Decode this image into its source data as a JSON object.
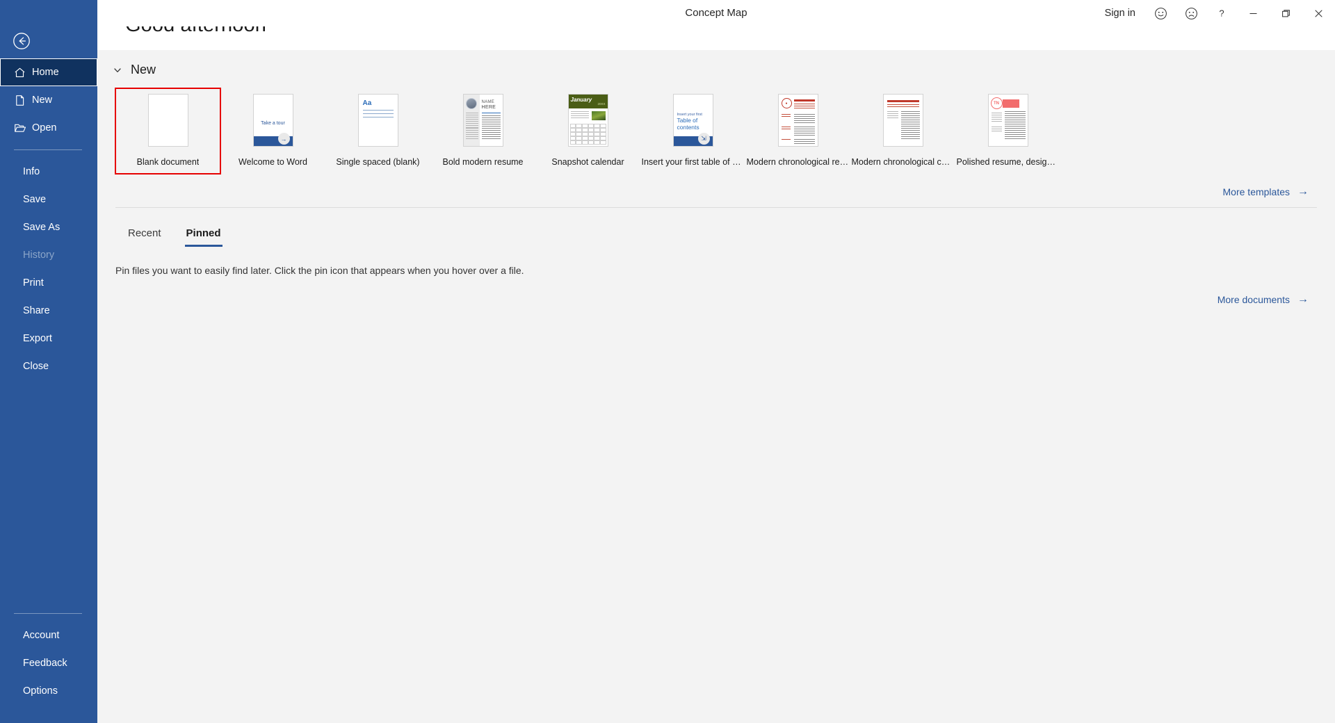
{
  "window": {
    "title": "Concept Map",
    "sign_in": "Sign in",
    "smiley_icon": "smiley-face-icon",
    "frown_icon": "frown-face-icon",
    "help_icon": "help-question-icon",
    "minimize_icon": "minimize-icon",
    "restore_icon": "restore-window-icon",
    "close_icon": "close-window-icon"
  },
  "sidebar": {
    "back_icon": "back-arrow-circle-icon",
    "accent_color": "#2b579a",
    "selected_color": "#10325f",
    "top_items": [
      {
        "label": "Home",
        "icon": "home-icon",
        "selected": true,
        "disabled": false
      },
      {
        "label": "New",
        "icon": "new-document-icon",
        "selected": false,
        "disabled": false
      },
      {
        "label": "Open",
        "icon": "open-folder-icon",
        "selected": false,
        "disabled": false
      }
    ],
    "mid_items": [
      {
        "label": "Info",
        "disabled": false
      },
      {
        "label": "Save",
        "disabled": false
      },
      {
        "label": "Save As",
        "disabled": false
      },
      {
        "label": "History",
        "disabled": true
      },
      {
        "label": "Print",
        "disabled": false
      },
      {
        "label": "Share",
        "disabled": false
      },
      {
        "label": "Export",
        "disabled": false
      },
      {
        "label": "Close",
        "disabled": false
      }
    ],
    "bottom_items": [
      {
        "label": "Account",
        "disabled": false
      },
      {
        "label": "Feedback",
        "disabled": false
      },
      {
        "label": "Options",
        "disabled": false
      }
    ]
  },
  "main": {
    "greeting": "Good afternoon",
    "new_section": {
      "title": "New",
      "collapse_icon": "chevron-down-icon",
      "selected_color": "#e60000",
      "templates": [
        {
          "label": "Blank document",
          "kind": "blank",
          "selected": true
        },
        {
          "label": "Welcome to Word",
          "kind": "tour",
          "tour_text": "Take a tour",
          "badge_icon": "arrow-right-icon"
        },
        {
          "label": "Single spaced (blank)",
          "kind": "singlespaced",
          "sample_text": "Aa"
        },
        {
          "label": "Bold modern resume",
          "kind": "resume-photo",
          "name_line1": "NAME",
          "name_line2": "HERE"
        },
        {
          "label": "Snapshot calendar",
          "kind": "calendar",
          "month": "January",
          "year": "20XX"
        },
        {
          "label": "Insert your first table of cont...",
          "kind": "toc",
          "toc_small": "Insert your first",
          "toc_big": "Table of contents",
          "badge_icon": "document-arrow-icon"
        },
        {
          "label": "Modern chronological resume",
          "kind": "red-resume"
        },
        {
          "label": "Modern chronological cover...",
          "kind": "red-cover"
        },
        {
          "label": "Polished resume, designed b...",
          "kind": "pink-resume",
          "monogram": "TN"
        }
      ]
    },
    "more_templates": {
      "label": "More templates",
      "icon": "arrow-right-icon"
    },
    "tabs": [
      {
        "label": "Recent",
        "active": false
      },
      {
        "label": "Pinned",
        "active": true
      }
    ],
    "empty_message": "Pin files you want to easily find later. Click the pin icon that appears when you hover over a file.",
    "more_documents": {
      "label": "More documents",
      "icon": "arrow-right-icon"
    }
  }
}
